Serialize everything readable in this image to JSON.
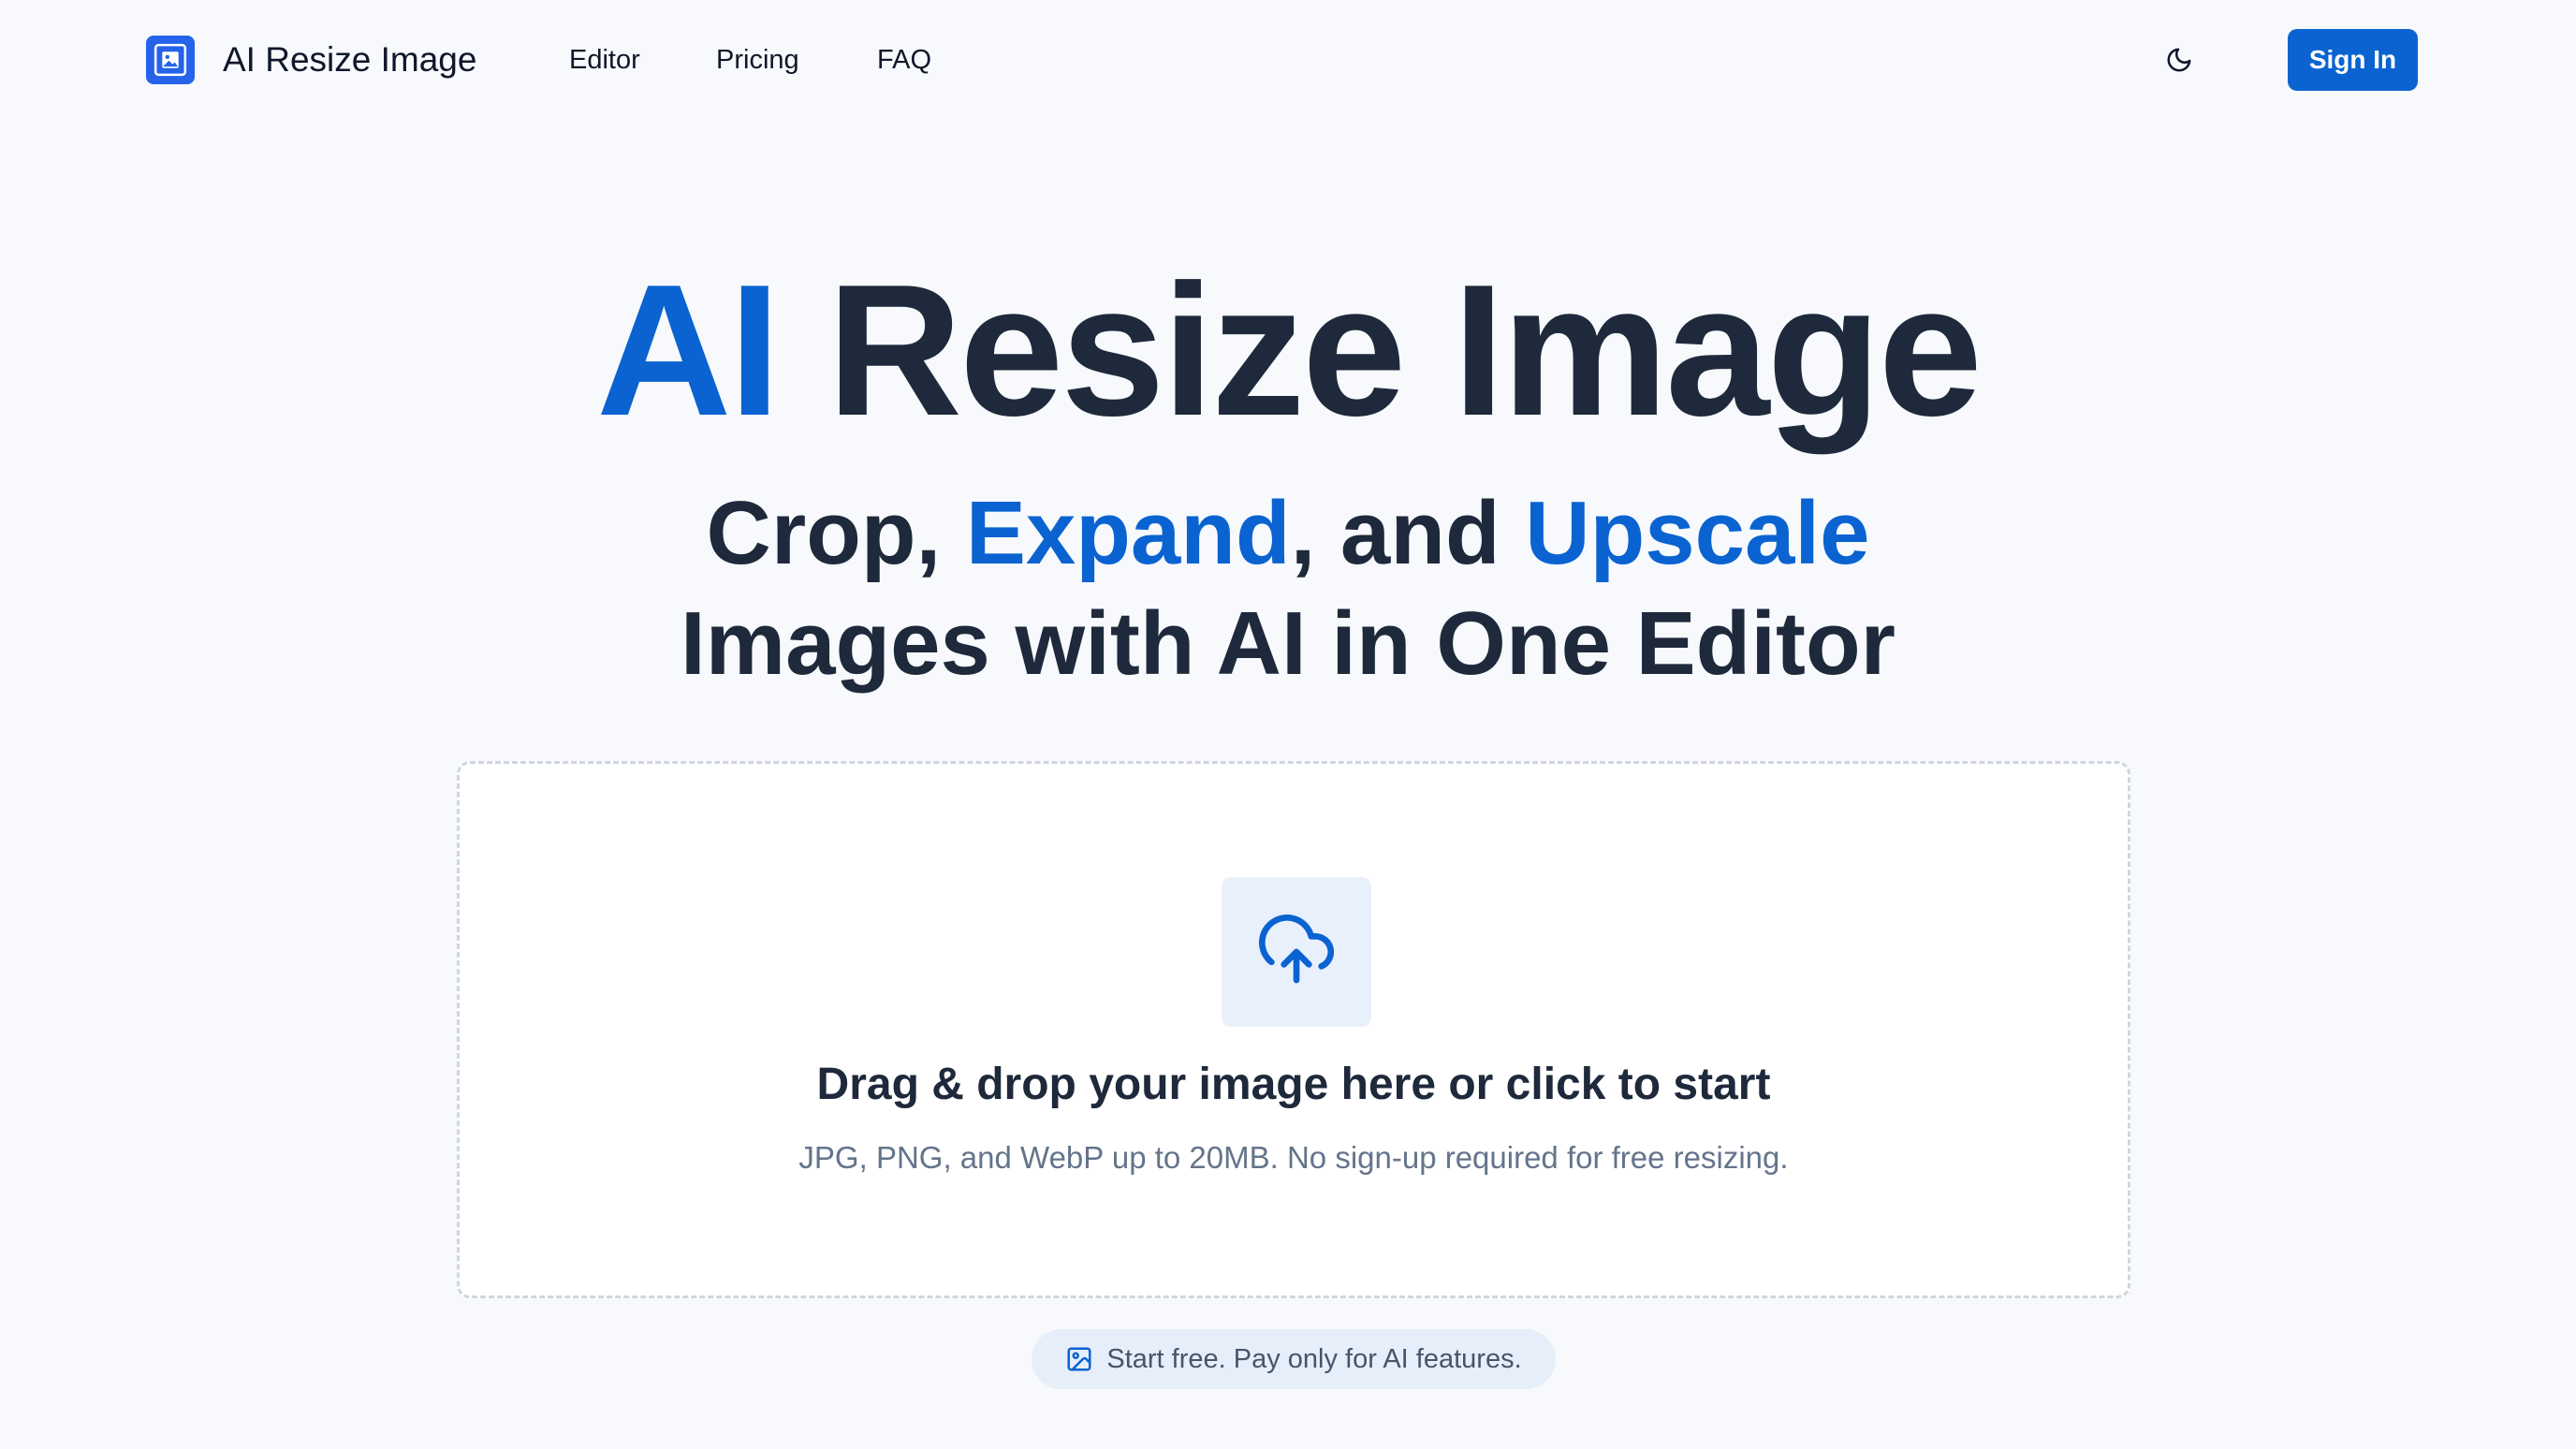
{
  "header": {
    "brand": "AI Resize Image",
    "logo_icon": "image-resize-icon",
    "nav": [
      "Editor",
      "Pricing",
      "FAQ"
    ],
    "theme_icon": "moon-icon",
    "signin_label": "Sign In"
  },
  "hero": {
    "title_accent": "AI",
    "title_rest": " Resize Image",
    "sub_line1": {
      "part1": "Crop, ",
      "accent1": "Expand",
      "part2": ", and ",
      "accent2": "Upscale"
    },
    "sub_line2": "Images with AI in One Editor"
  },
  "dropzone": {
    "icon": "cloud-upload-icon",
    "title": "Drag & drop your image here or click to start",
    "hint": "JPG, PNG, and WebP up to 20MB. No sign-up required for free resizing."
  },
  "pill": {
    "icon": "image-icon",
    "text": "Start free. Pay only for AI features."
  },
  "colors": {
    "accent": "#0a63d1",
    "background": "#f7f9fc",
    "text": "#1e293b",
    "muted": "#64748b"
  }
}
